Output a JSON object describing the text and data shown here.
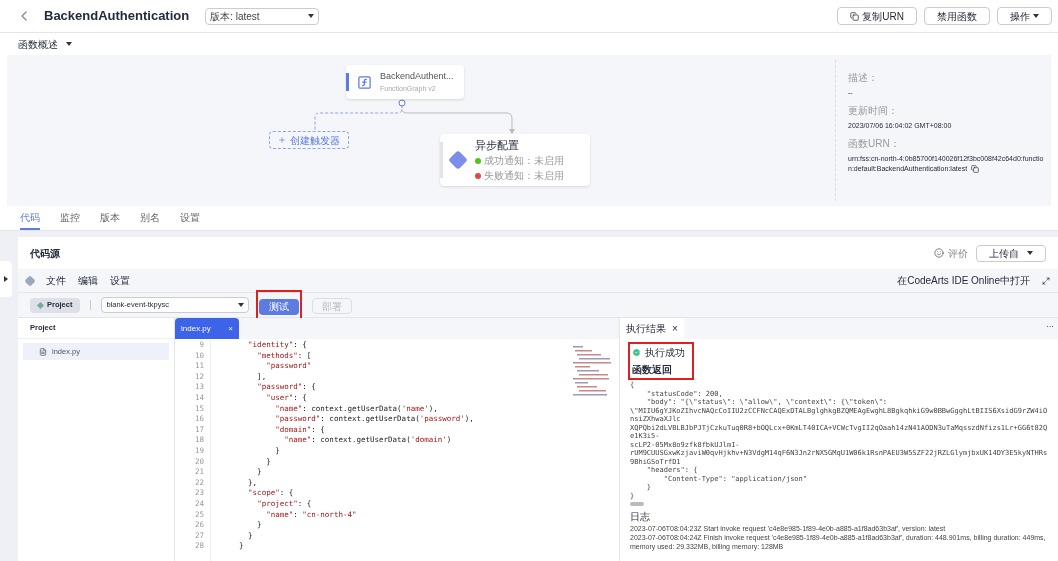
{
  "header": {
    "title": "BackendAuthentication",
    "version_select": "版本: latest",
    "buttons": [
      {
        "label": "复制URN",
        "kind": "copy"
      },
      {
        "label": "禁用函数",
        "kind": "plain"
      },
      {
        "label": "操作",
        "kind": "dropdown"
      }
    ]
  },
  "overview": {
    "title": "函数概述",
    "expanded": true,
    "function_node": {
      "name": "BackendAuthent...",
      "runtime": "FunctionGraph v2"
    },
    "trigger_button": "创建触发器",
    "async_node": {
      "title": "异步配置",
      "items": [
        {
          "text": "成功通知：未启用",
          "color": "#52c41a"
        },
        {
          "text": "失败通知：未启用",
          "color": "#e54545"
        }
      ]
    },
    "info": [
      {
        "label": "描述：",
        "value": "--",
        "copy": false
      },
      {
        "label": "更新时间：",
        "value": "2023/07/06 16:04:02 GMT+08:00",
        "copy": false
      },
      {
        "label": "函数URN：",
        "value": "urn:fss:cn-north-4:0b85700f140026f12f3bc008f42c64d0:function:default:BackendAuthentication:latest",
        "copy": true
      }
    ]
  },
  "tabs": [
    {
      "label": "代码",
      "selected": true
    },
    {
      "label": "监控",
      "selected": false
    },
    {
      "label": "版本",
      "selected": false
    },
    {
      "label": "别名",
      "selected": false
    },
    {
      "label": "设置",
      "selected": false
    }
  ],
  "code_source": {
    "title": "代码源",
    "feedback": "评价",
    "upload": "上传自"
  },
  "ide": {
    "menu": [
      "文件",
      "编辑",
      "设置"
    ],
    "open_external": "在CodeArts IDE Online中打开",
    "project_button": "Project",
    "event_select": "blank-event-tkpysc",
    "actions": [
      {
        "label": "测试",
        "disabled": false,
        "highlighted": true
      },
      {
        "label": "部署",
        "disabled": true,
        "highlighted": false
      }
    ],
    "explorer": {
      "title": "Project",
      "files": [
        {
          "name": "index.py",
          "selected": true
        }
      ]
    },
    "editor": {
      "tab": "index.py",
      "close": "×",
      "lines": [
        {
          "no": "9",
          "text": "      \"identity\": {"
        },
        {
          "no": "10",
          "text": "        \"methods\": ["
        },
        {
          "no": "11",
          "text": "          \"password\""
        },
        {
          "no": "12",
          "text": "        ],"
        },
        {
          "no": "13",
          "text": "        \"password\": {"
        },
        {
          "no": "14",
          "text": "          \"user\": {"
        },
        {
          "no": "15",
          "text": "            \"name\": context.getUserData('name'),"
        },
        {
          "no": "16",
          "text": "            \"password\": context.getUserData('password'),"
        },
        {
          "no": "17",
          "text": "            \"domain\": {"
        },
        {
          "no": "18",
          "text": "              \"name\": context.getUserData('domain')"
        },
        {
          "no": "19",
          "text": "            }"
        },
        {
          "no": "20",
          "text": "          }"
        },
        {
          "no": "21",
          "text": "        }"
        },
        {
          "no": "22",
          "text": "      },"
        },
        {
          "no": "23",
          "text": "      \"scope\": {"
        },
        {
          "no": "24",
          "text": "        \"project\": {"
        },
        {
          "no": "25",
          "text": "          \"name\": \"cn-north-4\""
        },
        {
          "no": "26",
          "text": "        }"
        },
        {
          "no": "27",
          "text": "      }"
        },
        {
          "no": "28",
          "text": "    }"
        }
      ]
    },
    "result": {
      "tab": "执行结果",
      "close": "×",
      "more": "···",
      "status": "执行成功",
      "return_title": "函数返回",
      "highlighted": true,
      "return_lines": [
        "{",
        "    \"statusCode\": 200,",
        "    \"body\": \"{\\\"status\\\": \\\"allow\\\", \\\"context\\\": {\\\"token\\\":",
        "\\\"MIIU6gYJKoZIhvcNAQcCoIIU2zCCFNcCAQExDTALBglghkgBZQMEAgEwghL8BgkqhkiG9w0BBwGgghLtBIIS6XsidG9rZW4iOnsiZXhwaXJlc",
        "XQPQbi2dLVBLBJbPJTjCzkuTuq0R8+bOQLcx+0KmLT40ICA+VCWcTvgII2qOaah14zN41AODN3uTaMqsszdNfizs1Lr+GG6t82Qe1K3i5-",
        "scLP2-05Mx8o9zfk8fbkUJlmI-",
        "rUM9CUUSGxwKzjaviW0qvHjkhv+N3VdgM14qF6N3Jn2rNX5GMqU1W06k1RsnPAEU3W5SZF22jRZLGlymjbxUK14DY3E5kyNTHRs9BhiGSoTrfD1",
        "    \"headers\": {",
        "        \"Content-Type\": \"application/json\"",
        "    }",
        "}"
      ],
      "log_title": "日志",
      "log_lines": [
        "2023-07-06T08:04:23Z Start invoke request 'c4e8e985-1f89-4e0b-a885-a1f8ad63b3af', version: latest",
        "2023-07-06T08:04:24Z Finish invoke request 'c4e8e985-1f89-4e0b-a885-a1f8ad63b3af', duration: 448.901ms, billing duration: 449ms, memory used: 29.332MB, billing memory: 128MB"
      ]
    }
  }
}
